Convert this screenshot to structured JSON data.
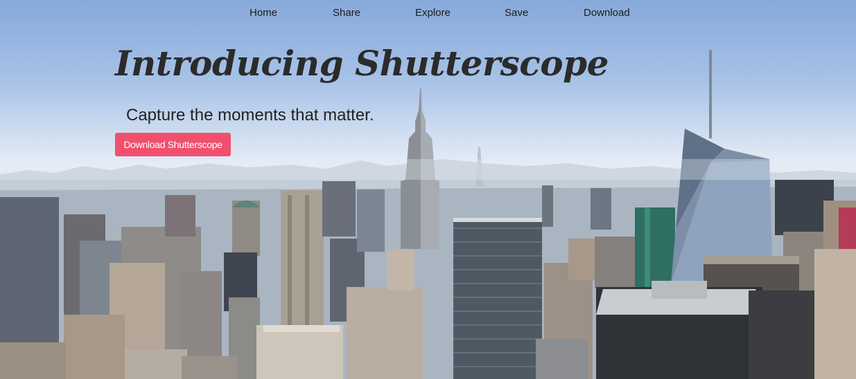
{
  "nav": {
    "items": [
      {
        "label": "Home"
      },
      {
        "label": "Share"
      },
      {
        "label": "Explore"
      },
      {
        "label": "Save"
      },
      {
        "label": "Download"
      }
    ]
  },
  "hero": {
    "title": "Introducing Shutterscope",
    "subtitle": "Capture the moments that matter.",
    "cta_label": "Download Shutterscope",
    "cta_color": "#f0506e"
  },
  "background": {
    "description_icon": "city-skyline-photo",
    "sky_color": "#a9c3e8"
  }
}
